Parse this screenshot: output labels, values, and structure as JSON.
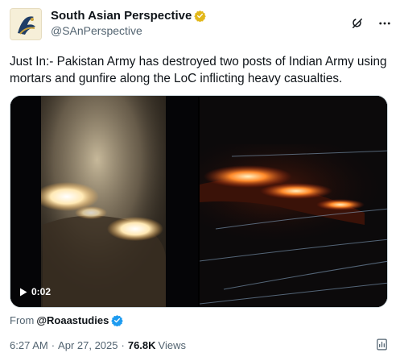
{
  "author": {
    "display_name": "South Asian Perspective",
    "handle": "@SAnPerspective"
  },
  "icons": {
    "avatar": "logo-avatar",
    "verified": "verified-gold-badge-icon",
    "grok": "grok-icon",
    "more": "more-icon",
    "play": "play-icon",
    "source_verified": "verified-blue-badge-icon",
    "stats": "stats-icon"
  },
  "tweet": {
    "text": "Just In:- Pakistan Army has destroyed two posts of Indian Army using mortars and gunfire along the LoC inflicting heavy casualties."
  },
  "media": {
    "duration": "0:02"
  },
  "source": {
    "prefix": "From",
    "handle": "@Roaastudies"
  },
  "meta": {
    "time": "6:27 AM",
    "separator": "·",
    "date": "Apr 27, 2025",
    "views_count": "76.8K",
    "views_label": "Views"
  },
  "colors": {
    "text_primary": "#0f1419",
    "text_secondary": "#536471",
    "verified_gold": "#e2b719",
    "verified_blue": "#1d9bf0",
    "fire": "#ff6a1a"
  }
}
